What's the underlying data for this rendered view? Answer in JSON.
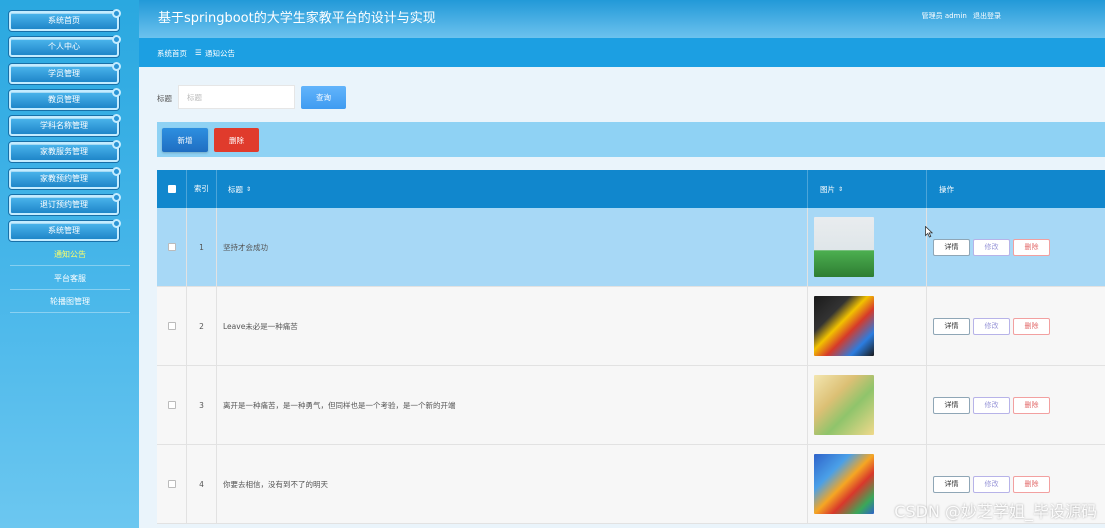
{
  "app": {
    "title": "基于springboot的大学生家教平台的设计与实现",
    "user_label": "管理员 admin",
    "logout_label": "退出登录"
  },
  "breadcrumb": {
    "home": "系统首页",
    "separator": "☰",
    "current": "通知公告"
  },
  "sidebar": {
    "items": [
      {
        "label": "系统首页"
      },
      {
        "label": "个人中心"
      },
      {
        "label": "学员管理"
      },
      {
        "label": "教员管理"
      },
      {
        "label": "学科名称管理"
      },
      {
        "label": "家教服务管理"
      },
      {
        "label": "家教预约管理"
      },
      {
        "label": "退订预约管理"
      },
      {
        "label": "系统管理"
      }
    ],
    "sub_items": [
      {
        "label": "通知公告",
        "active": true
      },
      {
        "label": "平台客服",
        "active": false
      },
      {
        "label": "轮播图管理",
        "active": false
      }
    ]
  },
  "search": {
    "label": "标题",
    "placeholder": "标题",
    "button_label": "查询"
  },
  "toolbar": {
    "add_label": "新增",
    "delete_label": "删除"
  },
  "table": {
    "columns": {
      "index": "索引",
      "title": "标题",
      "image": "图片",
      "actions": "操作"
    },
    "action_labels": {
      "view": "详情",
      "edit": "修改",
      "delete": "删除"
    },
    "rows": [
      {
        "index": "1",
        "title": "坚持才会成功",
        "image": "kids-mascot-photo"
      },
      {
        "index": "2",
        "title": "Leave未必是一种痛苦",
        "image": "classroom-toy-photo"
      },
      {
        "index": "3",
        "title": "离开是一种痛苦，是一种勇气，但同样也是一个考验，是一个新的开端",
        "image": "bright-room-photo"
      },
      {
        "index": "4",
        "title": "你要去相信，没有到不了的明天",
        "image": "colorful-playroom-photo"
      }
    ]
  },
  "watermark": "CSDN @妙芝学姐_毕设源码",
  "colors": {
    "header": "#2299d8",
    "breadcrumb_bar": "#1c9fe2",
    "table_header": "#1187cd",
    "selected_row": "#a7d8f6",
    "delete_button": "#e03b2c",
    "add_button": "#2d8fe0"
  }
}
